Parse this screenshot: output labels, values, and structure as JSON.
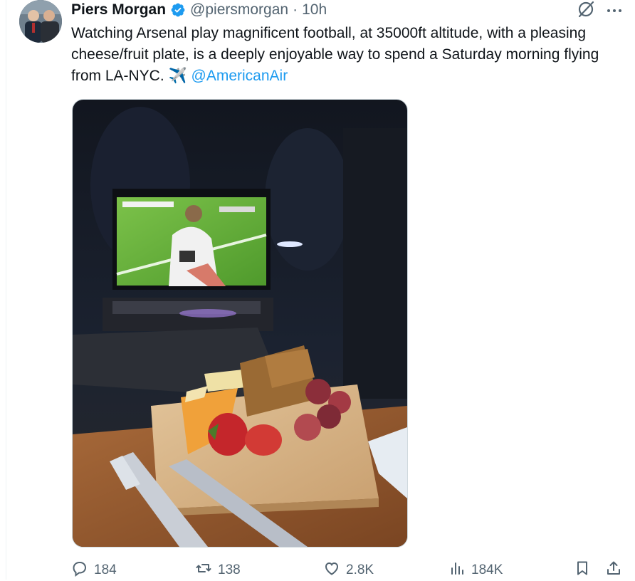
{
  "tweet": {
    "author_name": "Piers Morgan",
    "handle": "@piersmorgan",
    "separator": "·",
    "time": "10h",
    "text_before": "Watching Arsenal play magnificent football, at 35000ft altitude, with a pleasing cheese/fruit plate, is a deeply enjoyable way to spend a Saturday morning flying from LA-NYC. ✈️ ",
    "mention": "@AmericanAir"
  },
  "icons": {
    "verified": "verified-badge-icon",
    "grok": "grok-icon",
    "more": "more-icon",
    "reply": "reply-icon",
    "retweet": "retweet-icon",
    "like": "like-icon",
    "views": "views-icon",
    "bookmark": "bookmark-icon",
    "share": "share-icon"
  },
  "actions": {
    "replies": "184",
    "retweets": "138",
    "likes": "2.8K",
    "views": "184K"
  },
  "colors": {
    "accent": "#1d9bf0",
    "text": "#0f1419",
    "secondary": "#536471"
  }
}
